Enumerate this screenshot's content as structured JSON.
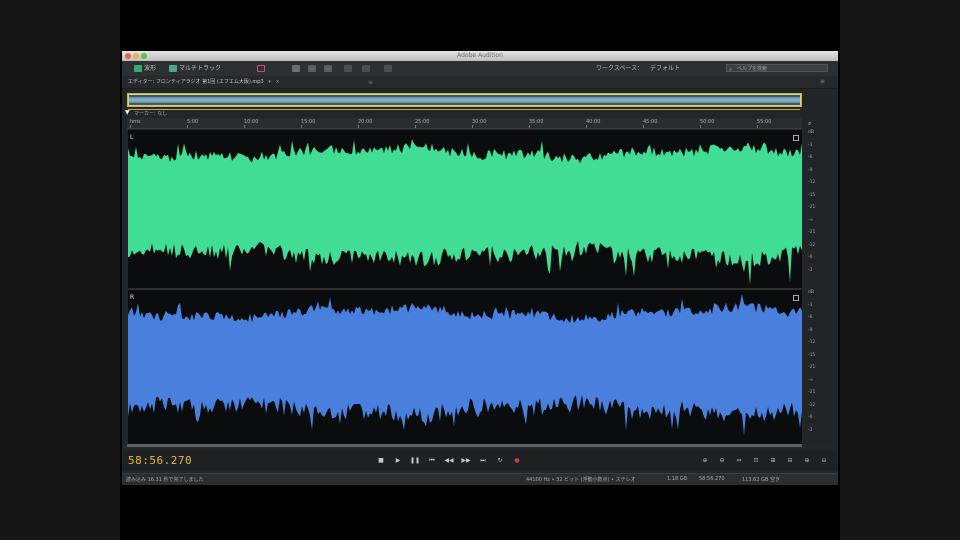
{
  "window": {
    "title": "Adobe Audition"
  },
  "toolbar": {
    "waveform_label": "波形",
    "multitrack_label": "マルチトラック",
    "workspace_label": "ワークスペース：",
    "workspace_value": "デフォルト",
    "search_placeholder": "ヘルプを検索"
  },
  "editor": {
    "tab_label": "エディター: フロンティアラジオ 第1回 (エフエム大阪).mp3",
    "tab_dropdown": "▾",
    "tab_close": "×",
    "tab_more": "≡"
  },
  "overview": {
    "marker_label": "マーカー: なし"
  },
  "ruler": {
    "ticks": [
      "hms",
      "5:00",
      "10:00",
      "15:00",
      "20:00",
      "25:00",
      "30:00",
      "35:00",
      "40:00",
      "45:00",
      "50:00",
      "55:00"
    ]
  },
  "channels": {
    "top_label": "L",
    "bottom_label": "R",
    "top_color": "#42dd95",
    "bottom_color": "#4a80dd"
  },
  "db_scale": {
    "top": [
      "dB",
      "-3",
      "-6",
      "-9",
      "-12",
      "-15",
      "-21",
      "-∞",
      "-21",
      "-12",
      "-6",
      "-3"
    ],
    "bottom": [
      "dB",
      "-3",
      "-6",
      "-9",
      "-12",
      "-15",
      "-21",
      "-∞",
      "-21",
      "-12",
      "-6",
      "-3"
    ]
  },
  "transport": {
    "time": "58:56.270",
    "stop": "■",
    "play": "▶",
    "pause": "❚❚",
    "to_start": "⏮",
    "rewind": "◀◀",
    "forward": "▶▶",
    "to_end": "⏭",
    "loop": "↻",
    "record": "●"
  },
  "zoom": {
    "buttons": [
      "⊕",
      "⊖",
      "⇔",
      "⊡",
      "⊞",
      "⊟",
      "⊕",
      "⊖"
    ]
  },
  "status": {
    "left": "読み込み 16.31 秒で完了しました",
    "format": "44100 Hz • 32 ビット (浮動小数点) • ステレオ",
    "selection": "1.18 GB",
    "duration": "58:56.270",
    "free": "113.62 GB 空き"
  }
}
